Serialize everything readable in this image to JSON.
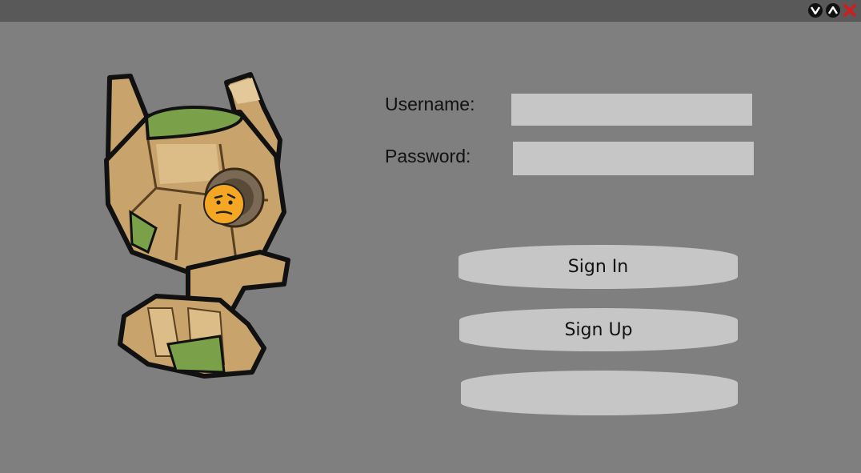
{
  "window": {
    "controls": [
      "minimize-icon",
      "maximize-icon",
      "close-icon"
    ]
  },
  "form": {
    "username_label": "Username:",
    "password_label": "Password:",
    "username_value": "",
    "password_value": ""
  },
  "buttons": {
    "sign_in": "Sign In",
    "sign_up": "Sign Up",
    "third": ""
  },
  "colors": {
    "background": "#7f7f7f",
    "titlebar": "#595959",
    "control": "#c6c6c6",
    "close": "#cc1f1f"
  }
}
